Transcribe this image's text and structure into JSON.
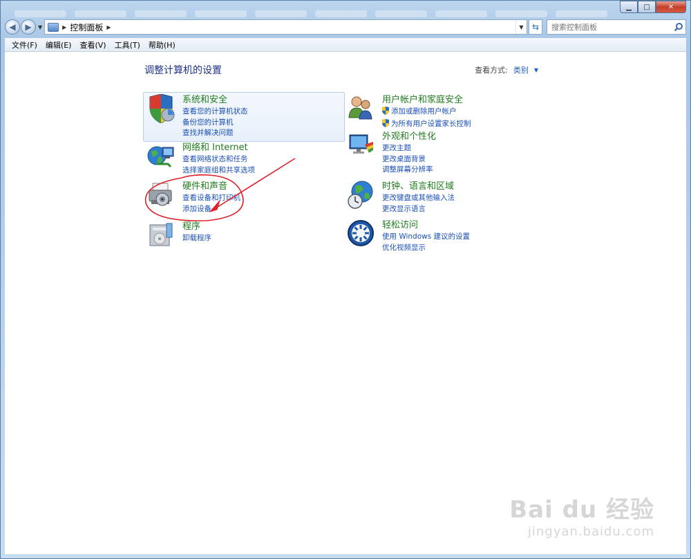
{
  "window": {
    "minimize_glyph": "▁",
    "maximize_glyph": "□",
    "close_glyph": "✕"
  },
  "nav": {
    "back_glyph": "◀",
    "forward_glyph": "▶",
    "breadcrumb": "控制面板",
    "search_placeholder": "搜索控制面板"
  },
  "menu": {
    "items": [
      "文件(F)",
      "编辑(E)",
      "查看(V)",
      "工具(T)",
      "帮助(H)"
    ]
  },
  "main": {
    "heading": "调整计算机的设置",
    "view_by_label": "查看方式:",
    "view_by_value": "类别",
    "categories": [
      {
        "title": "系统和安全",
        "icon": "shield-icon",
        "links": [
          "查看您的计算机状态",
          "备份您的计算机",
          "查找并解决问题"
        ]
      },
      {
        "title": "网络和 Internet",
        "icon": "network-icon",
        "links": [
          "查看网络状态和任务",
          "选择家庭组和共享选项"
        ]
      },
      {
        "title": "硬件和声音",
        "icon": "printer-icon",
        "links": [
          "查看设备和打印机",
          "添加设备"
        ]
      },
      {
        "title": "程序",
        "icon": "programs-icon",
        "links": [
          "卸载程序"
        ]
      },
      {
        "title": "用户帐户和家庭安全",
        "icon": "users-icon",
        "links": [
          "添加或删除用户帐户",
          "为所有用户设置家长控制"
        ]
      },
      {
        "title": "外观和个性化",
        "icon": "appearance-icon",
        "links": [
          "更改主题",
          "更改桌面背景",
          "调整屏幕分辨率"
        ]
      },
      {
        "title": "时钟、语言和区域",
        "icon": "clock-globe-icon",
        "links": [
          "更改键盘或其他输入法",
          "更改显示语言"
        ]
      },
      {
        "title": "轻松访问",
        "icon": "ease-of-access-icon",
        "links": [
          "使用 Windows 建议的设置",
          "优化视频显示"
        ]
      }
    ]
  },
  "annotation": {
    "color": "#e0202a"
  },
  "watermark": {
    "logo": "Bai du 经验",
    "url": "jingyan.baidu.com"
  },
  "colors": {
    "category_title": "#1f7d1f",
    "link": "#1a4fb8",
    "heading": "#1e3287"
  }
}
